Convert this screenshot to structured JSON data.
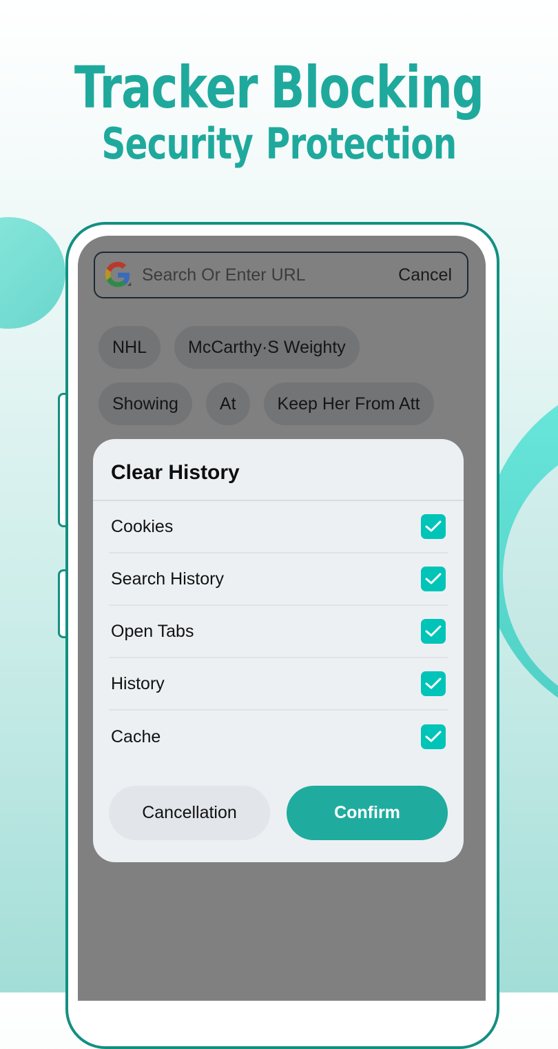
{
  "promo": {
    "headline_line1": [
      "Tracker",
      "Blocking"
    ],
    "headline_line2": [
      "Security",
      "Protection"
    ],
    "accent_color": "#1fa99d"
  },
  "browser": {
    "search": {
      "engine_icon": "google-g-icon",
      "placeholder": "Search Or Enter URL",
      "value": "",
      "cancel_label": "Cancel"
    },
    "history_chips": [
      [
        "NHL",
        "McCarthy·S Weighty"
      ],
      [
        "Showing",
        "At",
        "Keep Her From Att"
      ]
    ]
  },
  "dialog": {
    "title": "Clear History",
    "options": [
      {
        "label": "Cookies",
        "checked": true
      },
      {
        "label": "Search History",
        "checked": true
      },
      {
        "label": "Open Tabs",
        "checked": true
      },
      {
        "label": "History",
        "checked": true
      },
      {
        "label": "Cache",
        "checked": true
      }
    ],
    "cancel_label": "Cancellation",
    "confirm_label": "Confirm",
    "checkbox_color": "#00c4b8",
    "confirm_color": "#1fac9f"
  }
}
